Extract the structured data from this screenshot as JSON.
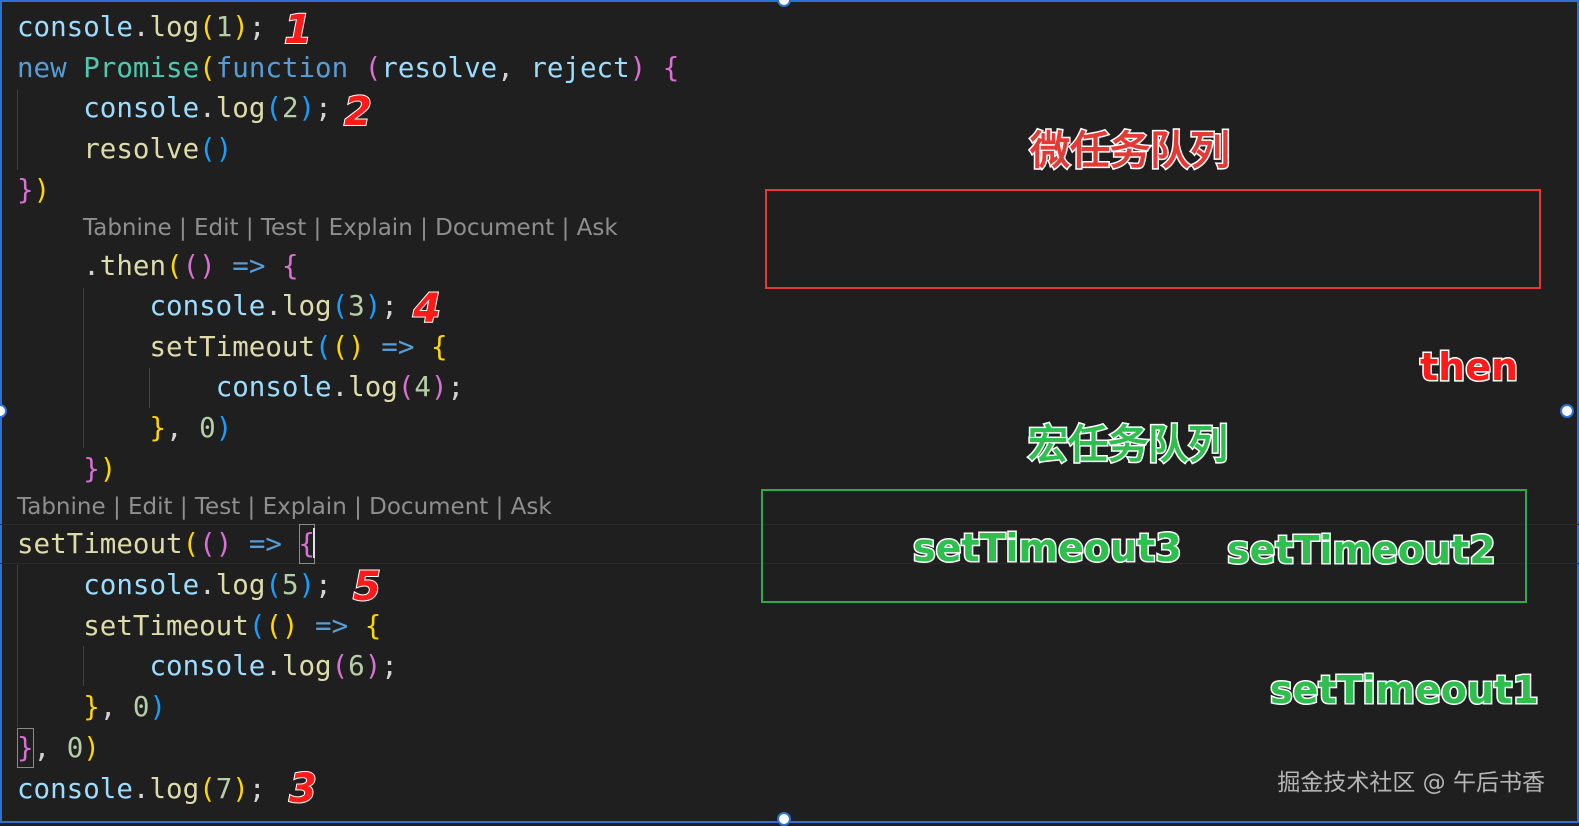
{
  "colors": {
    "selection_frame": "#2f6fd6",
    "micro_queue": "#e53935",
    "macro_queue": "#2fa84f",
    "annotation_red": "#ff1a1a",
    "annotation_green": "#2fbf4f"
  },
  "code": {
    "codelens_text": "Tabnine | Edit | Test | Explain | Document | Ask",
    "lines": [
      "console.log(1);",
      "new Promise(function (resolve, reject) {",
      "    console.log(2);",
      "    resolve()",
      "})",
      "    .then(() => {",
      "        console.log(3);",
      "        setTimeout(() => {",
      "            console.log(4);",
      "        }, 0)",
      "    })",
      "setTimeout(() => {",
      "    console.log(5);",
      "    setTimeout(() => {",
      "        console.log(6);",
      "    }, 0)",
      "}, 0)",
      "console.log(7);"
    ]
  },
  "annotations": {
    "order_numbers": [
      "1",
      "2",
      "4",
      "5",
      "3"
    ]
  },
  "queues": {
    "micro": {
      "title": "微任务队列",
      "outside_item": "then"
    },
    "macro": {
      "title": "宏任务队列",
      "items": [
        "setTimeout3",
        "setTimeout2"
      ],
      "outside_item": "setTimeout1"
    }
  },
  "watermark": "掘金技术社区 @ 午后书香"
}
